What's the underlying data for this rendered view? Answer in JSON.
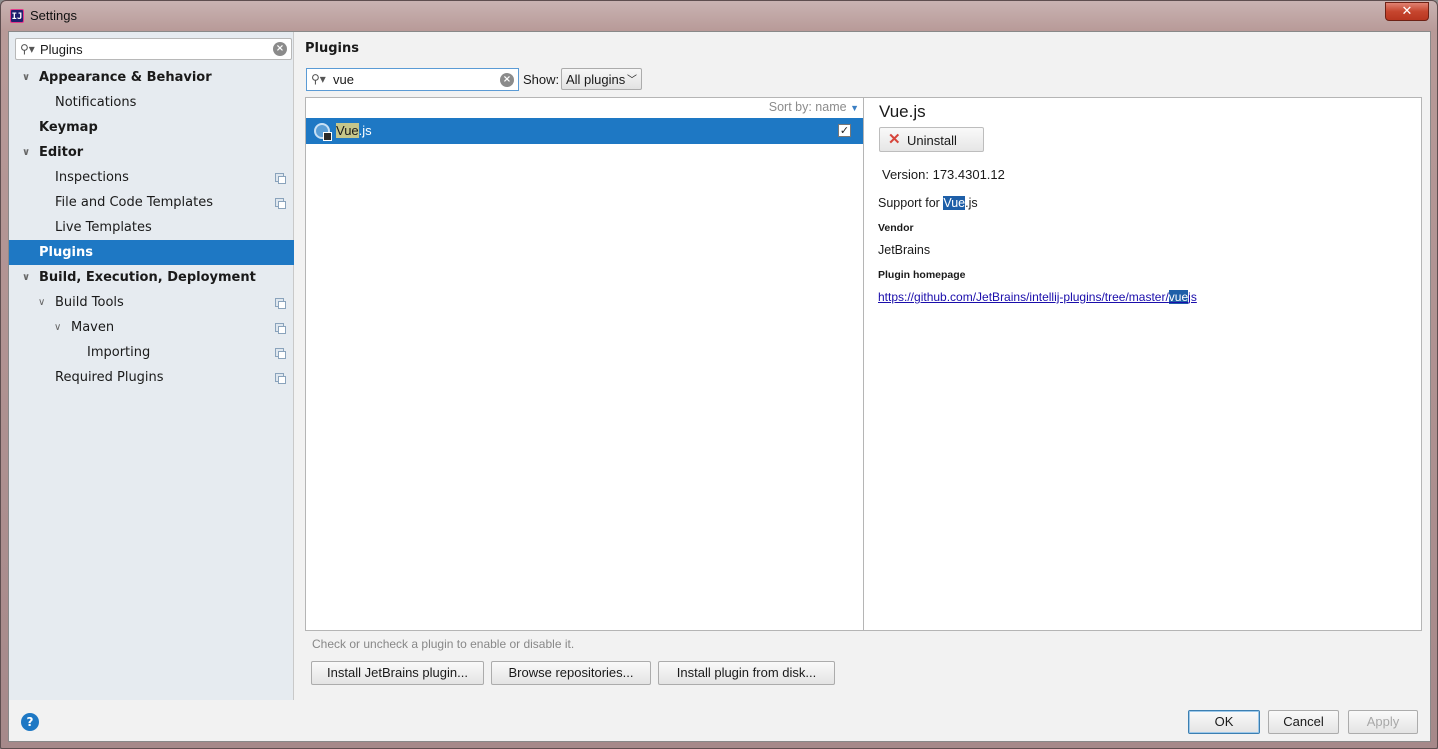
{
  "window": {
    "title": "Settings",
    "close_label": "✕"
  },
  "sidebar": {
    "search_value": "Plugins",
    "items": [
      {
        "label": "Appearance & Behavior",
        "level": 0,
        "bold": true,
        "arrow": "expanded",
        "copy": false,
        "selected": false
      },
      {
        "label": "Notifications",
        "level": 1,
        "bold": false,
        "arrow": "none",
        "copy": false,
        "selected": false
      },
      {
        "label": "Keymap",
        "level": 0,
        "bold": true,
        "arrow": "none",
        "copy": false,
        "selected": false
      },
      {
        "label": "Editor",
        "level": 0,
        "bold": true,
        "arrow": "expanded",
        "copy": false,
        "selected": false
      },
      {
        "label": "Inspections",
        "level": 1,
        "bold": false,
        "arrow": "none",
        "copy": true,
        "selected": false
      },
      {
        "label": "File and Code Templates",
        "level": 1,
        "bold": false,
        "arrow": "none",
        "copy": true,
        "selected": false
      },
      {
        "label": "Live Templates",
        "level": 1,
        "bold": false,
        "arrow": "none",
        "copy": false,
        "selected": false
      },
      {
        "label": "Plugins",
        "level": 0,
        "bold": true,
        "arrow": "none",
        "copy": false,
        "selected": true
      },
      {
        "label": "Build, Execution, Deployment",
        "level": 0,
        "bold": true,
        "arrow": "expanded",
        "copy": false,
        "selected": false
      },
      {
        "label": "Build Tools",
        "level": 1,
        "bold": false,
        "arrow": "expanded",
        "copy": true,
        "selected": false
      },
      {
        "label": "Maven",
        "level": 2,
        "bold": false,
        "arrow": "expanded",
        "copy": true,
        "selected": false
      },
      {
        "label": "Importing",
        "level": 3,
        "bold": false,
        "arrow": "none",
        "copy": true,
        "selected": false
      },
      {
        "label": "Required Plugins",
        "level": 1,
        "bold": false,
        "arrow": "none",
        "copy": true,
        "selected": false
      }
    ]
  },
  "main": {
    "title": "Plugins",
    "search_value": "vue",
    "show_label": "Show:",
    "show_value": "All plugins",
    "sort_label": "Sort by: name",
    "plugins": [
      {
        "name_match": "Vue",
        "name_rest": ".js",
        "enabled": true
      }
    ],
    "detail": {
      "name": "Vue.js",
      "uninstall_label": "Uninstall",
      "version": "Version: 173.4301.12",
      "desc_prefix": "Support for ",
      "desc_match": "Vue",
      "desc_rest": ".js",
      "vendor_heading": "Vendor",
      "vendor": "JetBrains",
      "homepage_heading": "Plugin homepage",
      "homepage_prefix": "https://github.com/JetBrains/intellij-plugins/tree/master/",
      "homepage_match": "vue",
      "homepage_rest": "js"
    },
    "hint": "Check or uncheck a plugin to enable or disable it.",
    "buttons": {
      "install_jetbrains": "Install JetBrains plugin...",
      "browse_repos": "Browse repositories...",
      "install_disk": "Install plugin from disk..."
    }
  },
  "footer": {
    "ok": "OK",
    "cancel": "Cancel",
    "apply": "Apply",
    "help": "?"
  }
}
